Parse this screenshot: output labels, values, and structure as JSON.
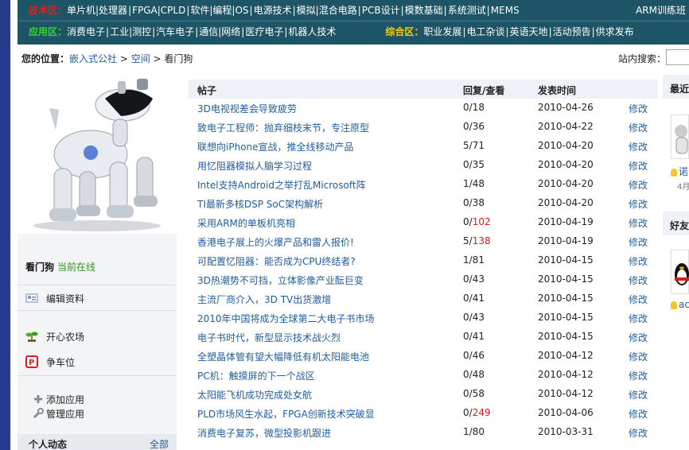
{
  "nav": {
    "row1_label": "技术区：",
    "row1_items": [
      "单片机|处理器",
      "FPGA|CPLD",
      "软件|编程|OS",
      "电源技术",
      "模拟|混合电路",
      "PCB设计",
      "模数基础",
      "系统测试",
      "MEMS"
    ],
    "row1_right": "ARM训练班",
    "row2_label": "应用区：",
    "row2_items": [
      "消费电子",
      "工业|测控",
      "汽车电子",
      "通信|网络",
      "医疗电子",
      "机器人技术"
    ],
    "row2_label2": "综合区：",
    "row2_items2": [
      "职业发展",
      "电工杂谈",
      "英语天地",
      "活动预告",
      "供求发布"
    ]
  },
  "breadcrumb": {
    "label": "您的位置：",
    "items": [
      "嵌入式公社",
      "空间",
      "看门狗"
    ]
  },
  "search": {
    "label": "站内搜索：",
    "value": ""
  },
  "profile": {
    "name": "看门狗",
    "status": "当前在线",
    "edit_label": "编辑资料",
    "apps": [
      "开心农场",
      "争车位"
    ],
    "add_app": "添加应用",
    "manage_app": "管理应用",
    "activity_title": "个人动态",
    "activity_all": "全部"
  },
  "table": {
    "headers": {
      "title": "帖子",
      "reply_view": "回复/查看",
      "time": "发表时间"
    },
    "edit_label": "修改",
    "rows": [
      {
        "title": "3D电视视差会导致疲劳",
        "replies": "0",
        "views": "18",
        "hot": false,
        "date": "2010-04-26"
      },
      {
        "title": "致电子工程师：抛弃细枝末节，专注原型",
        "replies": "0",
        "views": "36",
        "hot": false,
        "date": "2010-04-22"
      },
      {
        "title": "联想向iPhone宣战，推全线移动产品",
        "replies": "5",
        "views": "71",
        "hot": false,
        "date": "2010-04-20"
      },
      {
        "title": "用忆阻器模拟人脑学习过程",
        "replies": "0",
        "views": "35",
        "hot": false,
        "date": "2010-04-20"
      },
      {
        "title": "Intel支持Android之举打乱Microsoft阵",
        "replies": "1",
        "views": "48",
        "hot": false,
        "date": "2010-04-20"
      },
      {
        "title": "TI最新多核DSP SoC架构解析",
        "replies": "0",
        "views": "38",
        "hot": false,
        "date": "2010-04-20"
      },
      {
        "title": "采用ARM的单板机亮相",
        "replies": "0",
        "views": "102",
        "hot": true,
        "date": "2010-04-19"
      },
      {
        "title": "香港电子展上的火爆产品和雷人报价!",
        "replies": "5",
        "views": "138",
        "hot": true,
        "date": "2010-04-19"
      },
      {
        "title": "可配置忆阻器：能否成为CPU终结者?",
        "replies": "1",
        "views": "81",
        "hot": false,
        "date": "2010-04-15"
      },
      {
        "title": "3D热潮势不可挡，立体影像产业酝巨变",
        "replies": "0",
        "views": "43",
        "hot": false,
        "date": "2010-04-15"
      },
      {
        "title": "主流厂商介入，3D TV出货激增",
        "replies": "0",
        "views": "41",
        "hot": false,
        "date": "2010-04-15"
      },
      {
        "title": "2010年中国将成为全球第二大电子书市场",
        "replies": "0",
        "views": "43",
        "hot": false,
        "date": "2010-04-15"
      },
      {
        "title": "电子书时代，新型显示技术战火烈",
        "replies": "0",
        "views": "41",
        "hot": false,
        "date": "2010-04-15"
      },
      {
        "title": "全塑晶体管有望大幅降低有机太阳能电池",
        "replies": "0",
        "views": "46",
        "hot": false,
        "date": "2010-04-12"
      },
      {
        "title": "PC机：触摸屏的下一个战区",
        "replies": "0",
        "views": "48",
        "hot": false,
        "date": "2010-04-12"
      },
      {
        "title": "太阳能飞机成功完成处女航",
        "replies": "0",
        "views": "58",
        "hot": false,
        "date": "2010-04-12"
      },
      {
        "title": "PLD市场风生水起，FPGA创新技术突破显",
        "replies": "0",
        "views": "249",
        "hot": true,
        "date": "2010-04-06"
      },
      {
        "title": "消费电子复苏，微型投影机跟进",
        "replies": "1",
        "views": "80",
        "hot": false,
        "date": "2010-03-31"
      }
    ]
  },
  "right": {
    "box1_title": "最近",
    "box1_user": "诺",
    "box1_date": "4月",
    "box2_title": "好友",
    "box2_user": "ac"
  },
  "colors": {
    "nav_bg": "#1d5466",
    "link": "#225d9e",
    "hot": "#d61b1b",
    "online": "#2c9a1c"
  },
  "icons": [
    "card-icon",
    "sprout-icon",
    "parking-icon",
    "plus-icon",
    "wrench-icon",
    "robot-dog-photo",
    "avatar-icon",
    "bulb-icon",
    "penguin-icon"
  ]
}
